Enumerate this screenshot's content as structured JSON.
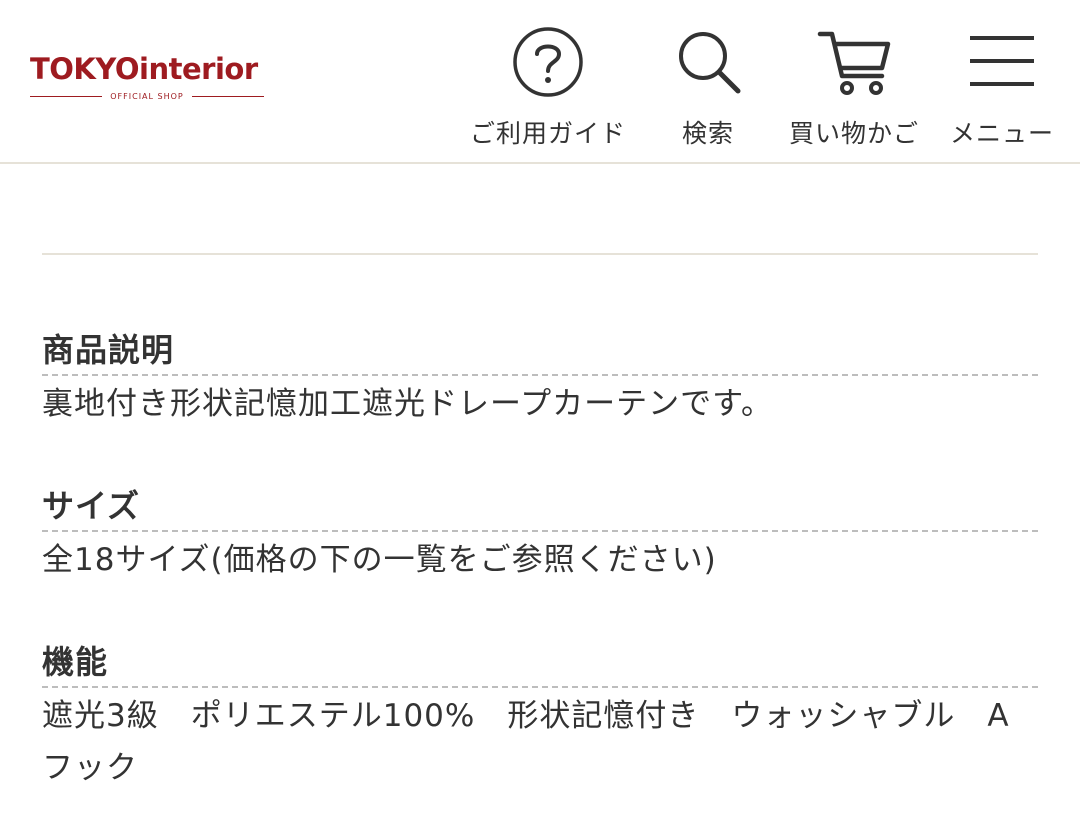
{
  "header": {
    "logo": {
      "tokyo": "TOKYO",
      "interior": "interior",
      "sub": "OFFICIAL SHOP"
    },
    "nav": [
      {
        "label": "ご利用ガイド",
        "icon": "help-circle-icon"
      },
      {
        "label": "検索",
        "icon": "search-icon"
      },
      {
        "label": "買い物かご",
        "icon": "cart-icon"
      },
      {
        "label": "メニュー",
        "icon": "hamburger-menu-icon"
      }
    ]
  },
  "product_details": [
    {
      "title": "商品説明",
      "body": "裏地付き形状記憶加工遮光ドレープカーテンです。"
    },
    {
      "title": "サイズ",
      "body": "全18サイズ(価格の下の一覧をご参照ください)"
    },
    {
      "title": "機能",
      "body": "遮光3級　ポリエステル100%　形状記憶付き　ウォッシャブル　Aフック"
    }
  ],
  "colors": {
    "brand": "#9e1b20",
    "text": "#333333",
    "divider": "#e6e2d8",
    "dashed": "#bdbdbd"
  }
}
